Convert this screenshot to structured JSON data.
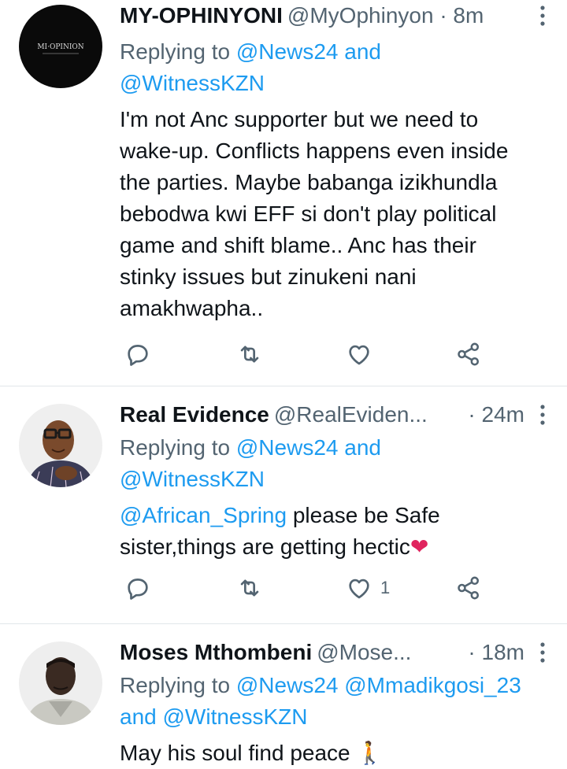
{
  "tweets": [
    {
      "name": "MY-OPHINYONI",
      "handle": "@MyOphinyon",
      "time": "· 8m",
      "reply_prefix": "Replying to ",
      "reply_link1": "@News24",
      "reply_mid": " and",
      "reply_link2": "@WitnessKZN",
      "text": "I'm not Anc supporter but we need to\nwake-up. Conflicts happens even inside\nthe parties. Maybe babanga izikhundla\nbebodwa kwi EFF si don't play political\ngame and shift blame.. Anc has their\nstinky issues but zinukeni nani\namakhwapha..",
      "avatar_text": "MI·OPINION",
      "like_count": ""
    },
    {
      "name": "Real Evidence",
      "handle": "@RealEviden...",
      "time": "· 24m",
      "reply_prefix": "Replying to ",
      "reply_link1": "@News24",
      "reply_mid": " and",
      "reply_link2": "@WitnessKZN",
      "mention": "@African_Spring",
      "text": " please be Safe\nsister,things are getting hectic",
      "emoji": "❤",
      "like_count": "1"
    },
    {
      "name": "Moses Mthombeni",
      "handle": "@Mose...",
      "time": "· 18m",
      "reply_prefix": "Replying to ",
      "reply_link1": "@News24",
      "reply_link1b": "@Mmadikgosi_23",
      "reply_mid": "and ",
      "reply_link2": "@WitnessKZN",
      "text": "May his soul find peace ",
      "emoji": "🚶"
    }
  ],
  "icons": {
    "reply": "reply-icon",
    "retweet": "retweet-icon",
    "like": "like-icon",
    "share": "share-icon",
    "more": "more-icon"
  },
  "colors": {
    "link": "#1d9bf0",
    "secondary": "#536471",
    "heart": "#e0245e"
  }
}
